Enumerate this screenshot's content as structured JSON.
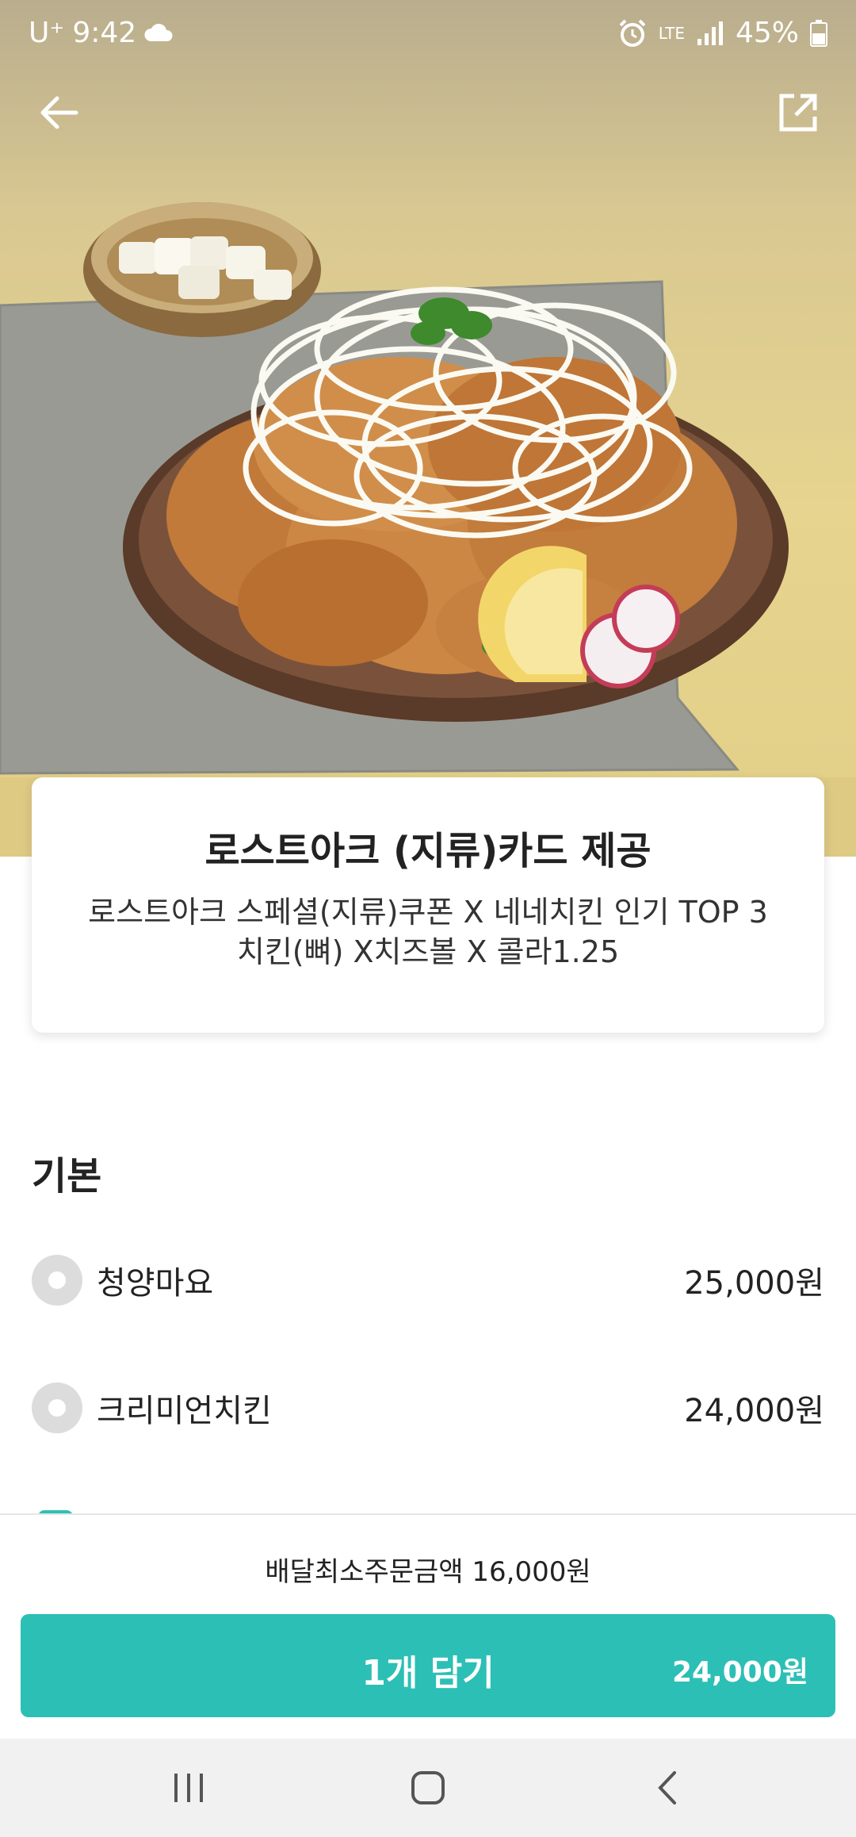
{
  "status_bar": {
    "carrier": "U⁺",
    "time": "9:42",
    "network": "LTE",
    "battery": "45%",
    "icons": [
      "cloud-icon",
      "alarm-icon",
      "signal-icon",
      "battery-icon"
    ]
  },
  "header": {
    "back_icon": "arrow-left-icon",
    "share_icon": "share-icon"
  },
  "product": {
    "title": "로스트아크 (지류)카드 제공",
    "description_line1": "로스트아크 스페셜(지류)쿠폰 X 네네치킨 인기 TOP 3",
    "description_line2": "치킨(뼈) X치즈볼 X 콜라1.25"
  },
  "options": {
    "section_title": "기본",
    "items": [
      {
        "name": "청양마요",
        "price": "25,000원"
      },
      {
        "name": "크리미언치킨",
        "price": "24,000원"
      }
    ]
  },
  "footer": {
    "min_order": "배달최소주문금액 16,000원",
    "add_label": "1개 담기",
    "add_price": "24,000원"
  },
  "colors": {
    "accent": "#2cbfb5",
    "radio": "#dcdcdc"
  },
  "nav": {
    "icons": [
      "recent-apps-icon",
      "home-icon",
      "back-icon"
    ]
  }
}
